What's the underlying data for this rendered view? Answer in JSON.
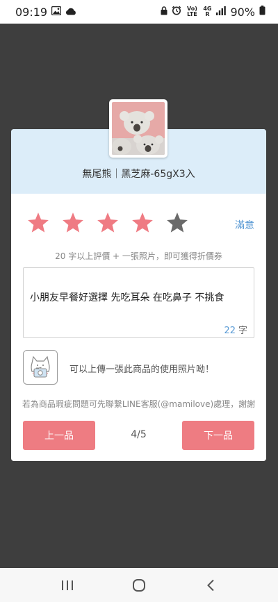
{
  "status_bar": {
    "time": "09:19",
    "left_icons": [
      "gallery-icon",
      "cloud-icon"
    ],
    "right_icons": [
      "lock-icon",
      "alarm-icon",
      "volte-icon",
      "signal-4g-icon",
      "signal-bars-icon"
    ],
    "volte_text": "Vo) LTE",
    "net_text": "4G R",
    "battery": "90%"
  },
  "product": {
    "name": "無尾熊｜黑芝麻-65gX3入",
    "image_icon": "koala-bun-image"
  },
  "rating": {
    "value": 4,
    "max": 5,
    "label": "滿意",
    "colors": {
      "active": "#ef7b83",
      "inactive": "#6a6a6a"
    }
  },
  "hint": "20 字以上評價 + 一張照片，即可獲得折價券",
  "review": {
    "text": "小朋友早餐好選擇 先吃耳朵 在吃鼻子 不挑食",
    "count": "22",
    "unit": "字"
  },
  "upload": {
    "icon": "cat-camera-icon",
    "text": "可以上傳一張此商品的使用照片呦！"
  },
  "notice": "若為商品瑕疵問題可先聯繫LINE客服(@mamilove)處理，謝謝",
  "nav": {
    "prev_label": "上一品",
    "next_label": "下一品",
    "page": "4/5"
  },
  "system_nav": {
    "icons": [
      "recent-apps-icon",
      "home-icon",
      "back-icon"
    ]
  },
  "colors": {
    "accent": "#ee7c82",
    "header_bg": "#dcedf9",
    "overlay": "#3e3e3e",
    "link_blue": "#5b9bd5"
  }
}
